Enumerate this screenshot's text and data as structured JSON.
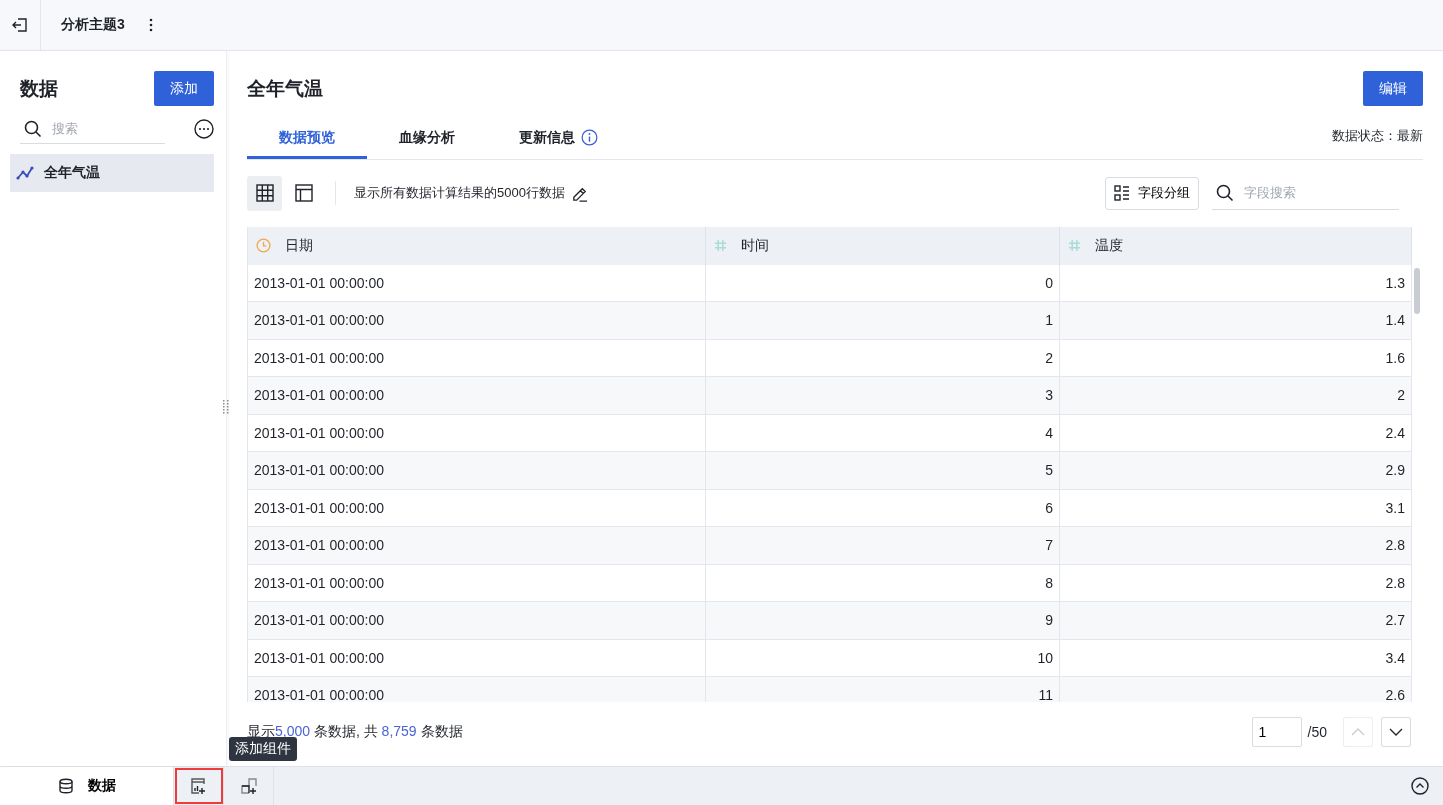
{
  "topbar": {
    "title": "分析主题3"
  },
  "sidebar": {
    "title": "数据",
    "add_button": "添加",
    "search": {
      "placeholder": "搜索"
    },
    "items": [
      {
        "label": "全年气温",
        "selected": true
      }
    ]
  },
  "main": {
    "title": "全年气温",
    "edit_button": "编辑",
    "status": "数据状态：最新",
    "tabs": [
      {
        "label": "数据预览",
        "selected": true,
        "info": false
      },
      {
        "label": "血缘分析",
        "selected": false,
        "info": false
      },
      {
        "label": "更新信息",
        "selected": false,
        "info": true
      }
    ]
  },
  "toolbar": {
    "views": [
      {
        "kind": "grid",
        "selected": true
      },
      {
        "kind": "layout",
        "selected": false
      }
    ],
    "note": "显示所有数据计算结果的5000行数据",
    "group_button": "字段分组",
    "field_search": {
      "placeholder": "字段搜索"
    }
  },
  "table": {
    "columns": [
      {
        "label": "日期",
        "kind": "date"
      },
      {
        "label": "时间",
        "kind": "number"
      },
      {
        "label": "温度",
        "kind": "number"
      }
    ],
    "rows": [
      [
        "2013-01-01 00:00:00",
        "0",
        "1.3"
      ],
      [
        "2013-01-01 00:00:00",
        "1",
        "1.4"
      ],
      [
        "2013-01-01 00:00:00",
        "2",
        "1.6"
      ],
      [
        "2013-01-01 00:00:00",
        "3",
        "2"
      ],
      [
        "2013-01-01 00:00:00",
        "4",
        "2.4"
      ],
      [
        "2013-01-01 00:00:00",
        "5",
        "2.9"
      ],
      [
        "2013-01-01 00:00:00",
        "6",
        "3.1"
      ],
      [
        "2013-01-01 00:00:00",
        "7",
        "2.8"
      ],
      [
        "2013-01-01 00:00:00",
        "8",
        "2.8"
      ],
      [
        "2013-01-01 00:00:00",
        "9",
        "2.7"
      ],
      [
        "2013-01-01 00:00:00",
        "10",
        "3.4"
      ],
      [
        "2013-01-01 00:00:00",
        "11",
        "2.6"
      ]
    ]
  },
  "footer": {
    "prefix": "显示",
    "shown": "5,000",
    "middle": "条数据, 共",
    "total": "8,759",
    "suffix": "条数据"
  },
  "pagination": {
    "page": "1",
    "of": "/50",
    "prev_disabled": true,
    "next_disabled": false
  },
  "tooltip": "添加组件",
  "bottombar": {
    "tabs": [
      {
        "kind": "data",
        "label": "数据",
        "highlighted": false
      },
      {
        "kind": "add-chart",
        "highlighted": true
      },
      {
        "kind": "add-layout",
        "highlighted": false
      }
    ]
  }
}
